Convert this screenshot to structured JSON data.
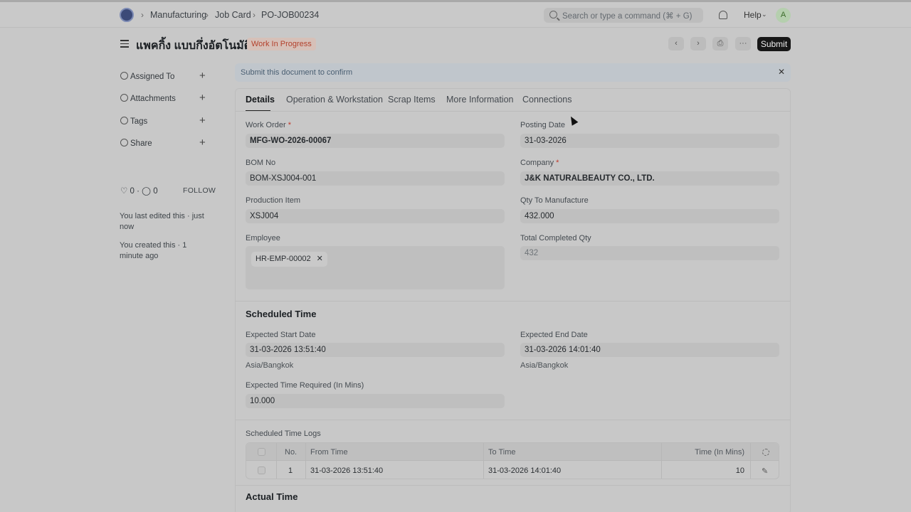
{
  "breadcrumb": [
    "Manufacturing",
    "Job Card",
    "PO-JOB00234"
  ],
  "search": {
    "placeholder": "Search or type a command (⌘ + G)"
  },
  "navbar": {
    "help": "Help",
    "avatar_initial": "A"
  },
  "doc": {
    "title": "แพคกิ้ง แบบกึ่งอัตโนมัติ",
    "status": "Work In Progress",
    "submit_label": "Submit"
  },
  "sidebar": {
    "items": [
      {
        "label": "Assigned To",
        "icon": "user-icon"
      },
      {
        "label": "Attachments",
        "icon": "paperclip-icon"
      },
      {
        "label": "Tags",
        "icon": "tag-icon"
      },
      {
        "label": "Share",
        "icon": "share-icon"
      }
    ],
    "likes": "0",
    "comments": "0",
    "follow": "FOLLOW",
    "last_edited": "You last edited this · just now",
    "created": "You created this · 1 minute ago"
  },
  "alert": {
    "text": "Submit this document to confirm"
  },
  "tabs": [
    "Details",
    "Operation & Workstation",
    "Scrap Items",
    "More Information",
    "Connections"
  ],
  "fields": {
    "work_order": {
      "label": "Work Order",
      "value": "MFG-WO-2026-00067"
    },
    "posting_date": {
      "label": "Posting Date",
      "value": "31-03-2026"
    },
    "bom_no": {
      "label": "BOM No",
      "value": "BOM-XSJ004-001"
    },
    "company": {
      "label": "Company",
      "value": "J&K NATURALBEAUTY CO., LTD."
    },
    "production_item": {
      "label": "Production Item",
      "value": "XSJ004"
    },
    "qty_to_manufacture": {
      "label": "Qty To Manufacture",
      "value": "432.000"
    },
    "employee": {
      "label": "Employee",
      "value": "HR-EMP-00002"
    },
    "total_completed_qty": {
      "label": "Total Completed Qty",
      "value": "432"
    }
  },
  "scheduled": {
    "title": "Scheduled Time",
    "start_label": "Expected Start Date",
    "start_value": "31-03-2026 13:51:40",
    "end_label": "Expected End Date",
    "end_value": "31-03-2026 14:01:40",
    "timezone": "Asia/Bangkok",
    "time_required_label": "Expected Time Required (In Mins)",
    "time_required_value": "10.000"
  },
  "time_logs": {
    "title": "Scheduled Time Logs",
    "headers": [
      "No.",
      "From Time",
      "To Time",
      "Time (In Mins)"
    ],
    "rows": [
      {
        "no": "1",
        "from": "31-03-2026 13:51:40",
        "to": "31-03-2026 14:01:40",
        "mins": "10"
      }
    ]
  },
  "actual": {
    "title": "Actual Time"
  }
}
